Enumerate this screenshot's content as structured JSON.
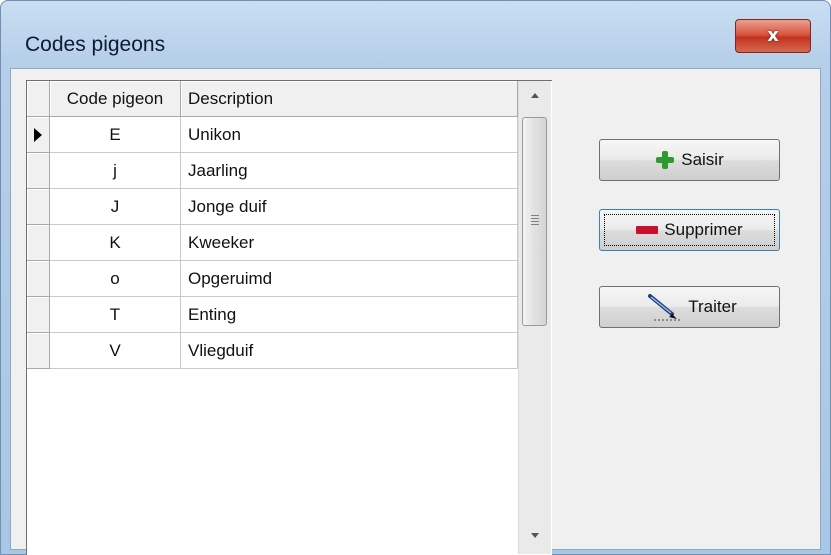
{
  "window": {
    "title": "Codes pigeons",
    "close_label": "x"
  },
  "grid": {
    "columns": [
      "Code pigeon",
      "Description"
    ],
    "rows": [
      {
        "code": "E",
        "description": "Unikon",
        "current": true
      },
      {
        "code": "j",
        "description": "Jaarling"
      },
      {
        "code": "J",
        "description": "Jonge duif"
      },
      {
        "code": "K",
        "description": "Kweeker"
      },
      {
        "code": "o",
        "description": "Opgeruimd"
      },
      {
        "code": "T",
        "description": "Enting"
      },
      {
        "code": "V",
        "description": "Vliegduif"
      }
    ]
  },
  "buttons": {
    "saisir": "Saisir",
    "supprimer": "Supprimer",
    "traiter": "Traiter"
  },
  "icons": {
    "saisir": "plus-icon",
    "supprimer": "minus-icon",
    "traiter": "pen-icon"
  },
  "colors": {
    "close_button": "#d04a35",
    "plus": "#2e9a2e",
    "minus": "#c8102e"
  }
}
